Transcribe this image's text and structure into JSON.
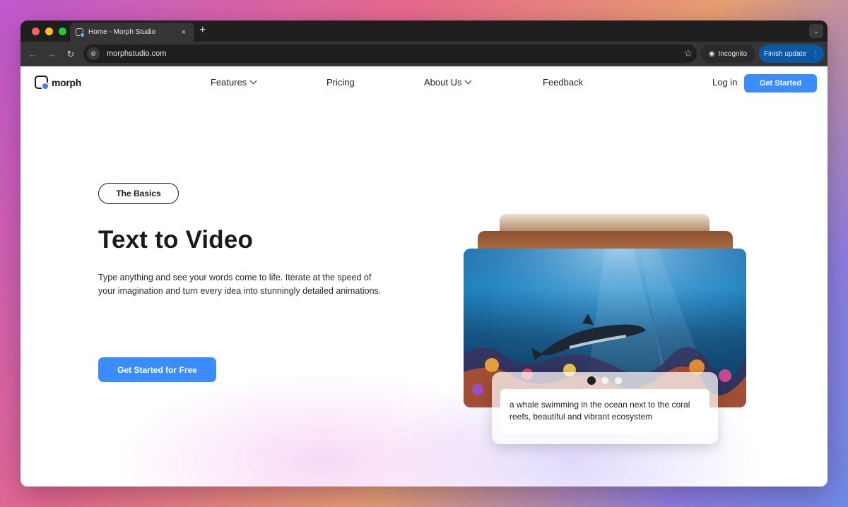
{
  "browser": {
    "tab_title": "Home - Morph Studio",
    "new_tab_symbol": "+",
    "close_symbol": "×",
    "url": "morphstudio.com",
    "incognito_label": "Incognito",
    "finish_update_label": "Finish update"
  },
  "site": {
    "logo_text": "morph",
    "nav": {
      "features": "Features",
      "pricing": "Pricing",
      "about": "About Us",
      "feedback": "Feedback"
    },
    "login": "Log in",
    "get_started": "Get Started"
  },
  "hero": {
    "badge": "The Basics",
    "title": "Text to Video",
    "description": "Type anything and see your words come to life. Iterate at the speed of your imagination and turn every idea into stunningly detailed animations.",
    "cta": "Get Started for Free"
  },
  "showcase": {
    "caption": "a whale swimming in the ocean next to the coral reefs, beautiful and vibrant ecosystem",
    "active_slide": 1,
    "slide_count": 3
  },
  "colors": {
    "accent": "#3b8cff",
    "text": "#1a1a1a",
    "chrome_dark": "#1f1f1f",
    "chrome_toolbar": "#353535",
    "update_button": "#0b57a4"
  }
}
